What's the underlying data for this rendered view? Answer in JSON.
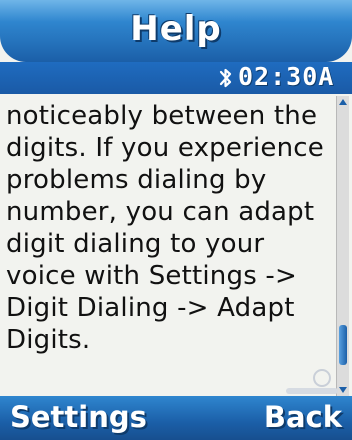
{
  "header": {
    "title": "Help"
  },
  "status": {
    "bluetooth_icon": "bluetooth-icon",
    "time": "02:30A"
  },
  "content": {
    "lines": [
      "noticeably between the",
      "digits. If you experience",
      "problems dialing by",
      "number, you can adapt",
      "digit dialing to your",
      "voice with Settings ->",
      "Digit Dialing -> Adapt",
      "Digits."
    ],
    "scroll_position": 0.92
  },
  "softkeys": {
    "left_label": "Settings",
    "right_label": "Back"
  },
  "colors": {
    "title_bar": "#2f86cf",
    "status_bar": "#1a5aa6",
    "content_background": "#f2f3ef",
    "text": "#111111"
  }
}
